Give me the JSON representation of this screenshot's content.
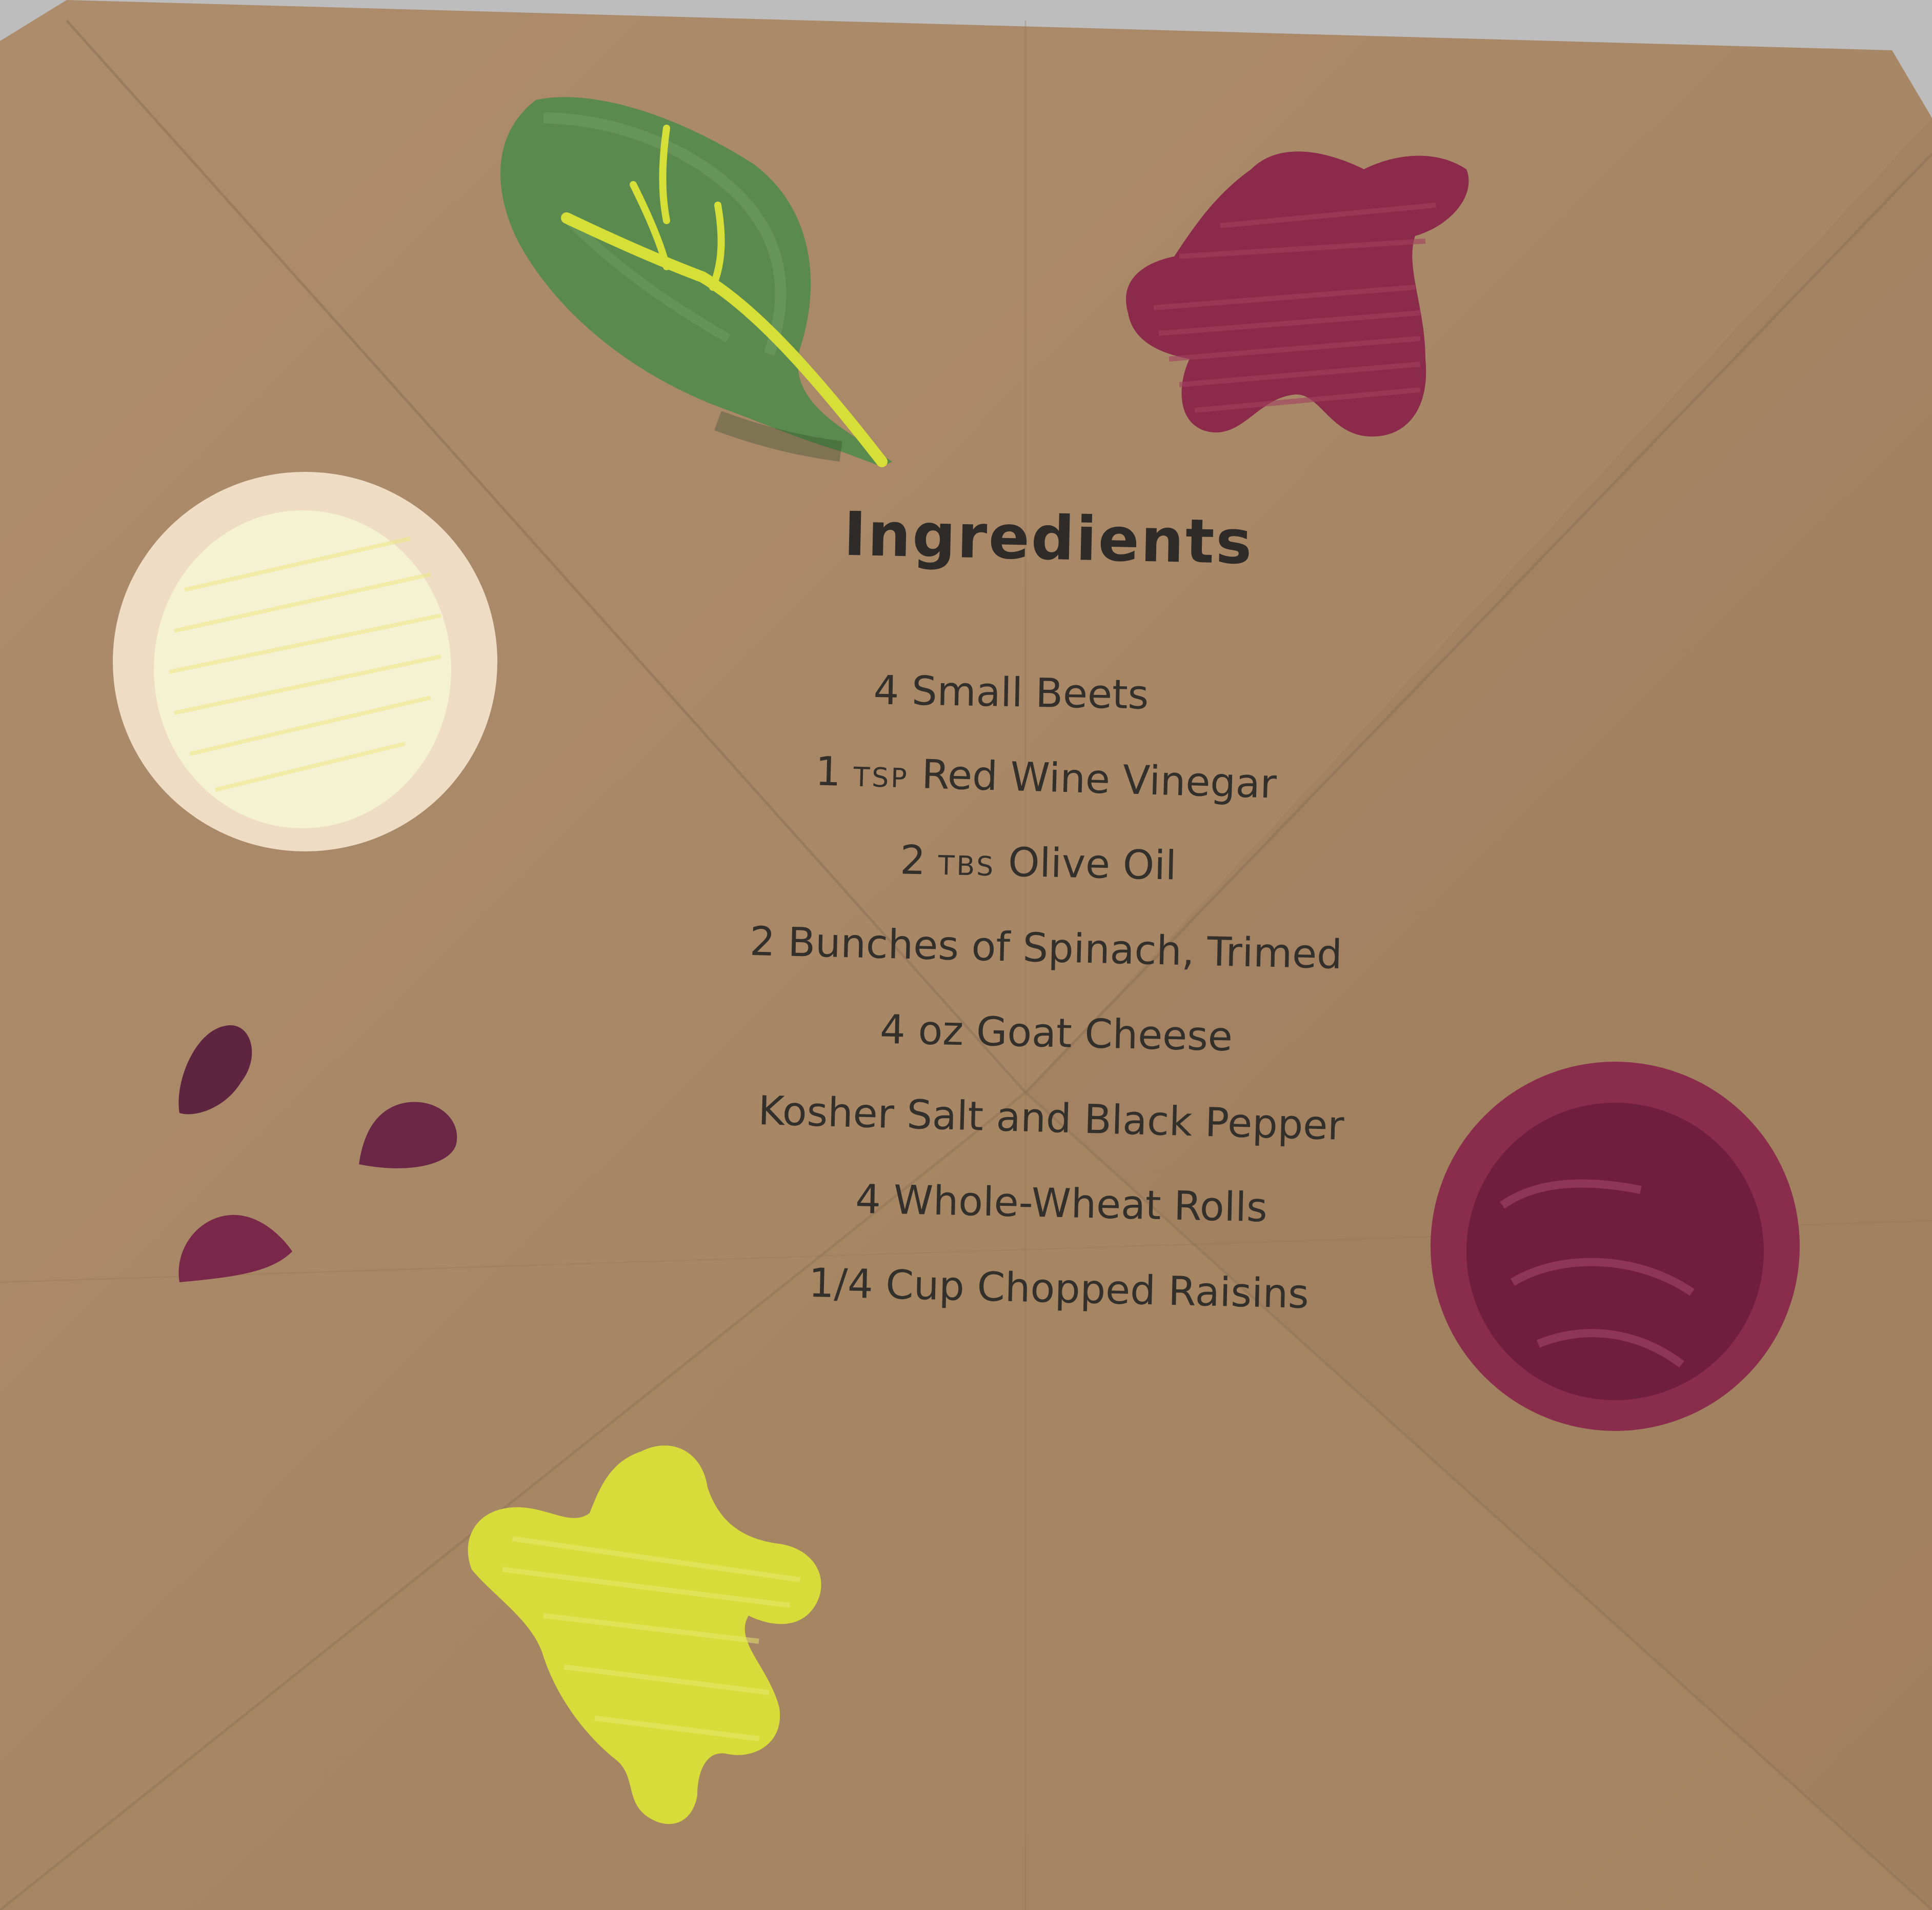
{
  "colors": {
    "kraft_paper": "#a88766",
    "kraft_shadow": "#9a7a5b",
    "spinach_leaf": "#5c8a4f",
    "leaf_vein": "#d6de38",
    "beet_red": "#8c2a4c",
    "goat_cheese": "#f4f0d2",
    "cheese_rim": "#f0dcc4",
    "yellow_piece": "#d8dc3a",
    "text": "#2f2a26"
  },
  "card": {
    "title": "Ingredients",
    "ingredients": [
      {
        "qty": "4",
        "unit": "",
        "item": "Small Beets"
      },
      {
        "qty": "1",
        "unit": "TSP",
        "item": "Red Wine Vinegar"
      },
      {
        "qty": "2",
        "unit": "TBS",
        "item": "Olive Oil"
      },
      {
        "qty": "2",
        "unit": "",
        "item": "Bunches of Spinach, Trimed"
      },
      {
        "qty": "4",
        "unit": "oz",
        "item": "Goat Cheese"
      },
      {
        "qty": "",
        "unit": "",
        "item": "Kosher Salt and Black Pepper"
      },
      {
        "qty": "4",
        "unit": "",
        "item": "Whole-Wheat Rolls"
      },
      {
        "qty": "1/4",
        "unit": "",
        "item": "Cup Chopped Raisins"
      }
    ]
  },
  "cutouts": [
    {
      "name": "spinach-leaf",
      "depicts": "spinach leaf"
    },
    {
      "name": "beet-slice-blob",
      "depicts": "beet piece"
    },
    {
      "name": "goat-cheese-round",
      "depicts": "goat cheese round"
    },
    {
      "name": "raisin-pieces",
      "depicts": "raisins"
    },
    {
      "name": "beet-round",
      "depicts": "whole beet"
    },
    {
      "name": "yellow-blob",
      "depicts": "yellow piece"
    }
  ]
}
